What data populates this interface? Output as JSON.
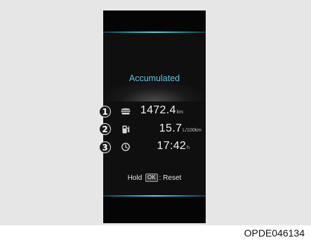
{
  "display": {
    "title": "Accumulated",
    "rows": [
      {
        "marker": "1",
        "icon": "road-icon",
        "value": "1472.4",
        "unit": "km"
      },
      {
        "marker": "2",
        "icon": "fuel-pump-icon",
        "value": "15.7",
        "unit": "L/100km"
      },
      {
        "marker": "3",
        "icon": "clock-icon",
        "value": "17:42",
        "unit": "h"
      }
    ],
    "reset_hint": {
      "prefix": "Hold",
      "key": "OK",
      "suffix": ": Reset"
    }
  },
  "figure_code": "OPDE046134",
  "colors": {
    "title": "#5ec4e0",
    "accent_line": "#5fd3e2",
    "screen_bg": "#0f0f0f",
    "panel_bg": "#e6e6e6"
  }
}
